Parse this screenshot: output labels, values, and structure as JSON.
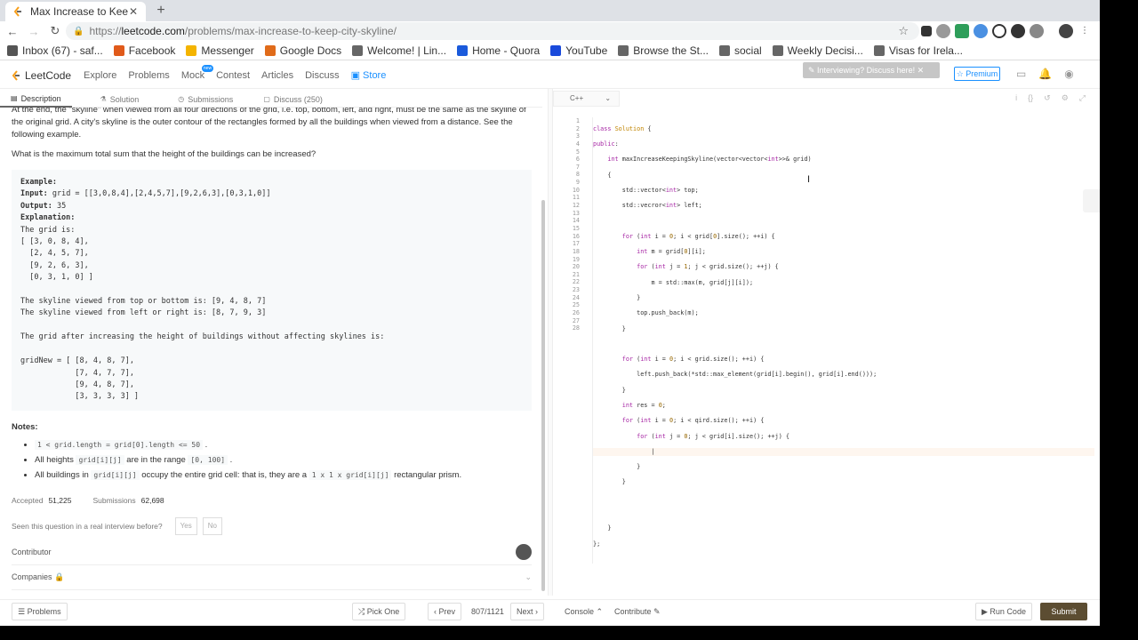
{
  "browser": {
    "tab_title": "Max Increase to Keep City",
    "new_tab_label": "+",
    "url": "https://leetcode.com/problems/max-increase-to-keep-city-skyline/",
    "url_scheme": "https://",
    "url_host": "leetcode.com",
    "url_path": "/problems/max-increase-to-keep-city-skyline/"
  },
  "bookmarks": [
    {
      "label": "Inbox (67) - saf...",
      "icon": "gmail-icon",
      "color": "#555555"
    },
    {
      "label": "Facebook",
      "icon": "facebook-icon",
      "color": "#e05a1a"
    },
    {
      "label": "Messenger",
      "icon": "messenger-icon",
      "color": "#f4b400"
    },
    {
      "label": "Google Docs",
      "icon": "docs-icon",
      "color": "#e06b1a"
    },
    {
      "label": "Welcome! | Lin...",
      "icon": "globe-icon",
      "color": "#666666"
    },
    {
      "label": "Home - Quora",
      "icon": "quora-icon",
      "color": "#1a5adb"
    },
    {
      "label": "YouTube",
      "icon": "youtube-icon",
      "color": "#1a4adb"
    },
    {
      "label": "Browse the St...",
      "icon": "globe-icon",
      "color": "#666666"
    },
    {
      "label": "social",
      "icon": "folder-icon",
      "color": "#666666"
    },
    {
      "label": "Weekly Decisi...",
      "icon": "globe-icon",
      "color": "#666666"
    },
    {
      "label": "Visas for Irela...",
      "icon": "globe-icon",
      "color": "#666666"
    }
  ],
  "nav": {
    "logo": "LeetCode",
    "links": [
      "Explore",
      "Problems",
      "Mock",
      "Contest",
      "Articles",
      "Discuss"
    ],
    "store": "Store",
    "new_badge": "new",
    "interview": "Interviewing? Discuss here!",
    "premium": "Premium"
  },
  "desc_tabs": [
    "Description",
    "Solution",
    "Submissions",
    "Discuss (250)"
  ],
  "description": {
    "para1": "At the end, the \"skyline\" when viewed from all four directions of the grid, i.e. top, bottom, left, and right, must be the same as the skyline of the original grid. A city's skyline is the outer contour of the rectangles formed by all the buildings when viewed from a distance. See the following example.",
    "para2": "What is the maximum total sum that the height of the buildings can be increased?",
    "example_label": "Example:",
    "input_label": "Input:",
    "input_value": " grid = [[3,0,8,4],[2,4,5,7],[9,2,6,3],[0,3,1,0]]",
    "output_label": "Output:",
    "output_value": " 35",
    "explanation_label": "Explanation:",
    "explanation_body": "The grid is:\n[ [3, 0, 8, 4],\n  [2, 4, 5, 7],\n  [9, 2, 6, 3],\n  [0, 3, 1, 0] ]\n\nThe skyline viewed from top or bottom is: [9, 4, 8, 7]\nThe skyline viewed from left or right is: [8, 7, 9, 3]\n\nThe grid after increasing the height of buildings without affecting skylines is:\n\ngridNew = [ [8, 4, 8, 7],\n            [7, 4, 7, 7],\n            [9, 4, 8, 7],\n            [3, 3, 3, 3] ]",
    "notes_title": "Notes:",
    "note1_code": "1 < grid.length = grid[0].length <= 50",
    "note1_tail": ".",
    "note2_pre": "All heights",
    "note2_code1": "grid[i][j]",
    "note2_mid": "are in the range",
    "note2_code2": "[0, 100]",
    "note2_tail": ".",
    "note3_pre": "All buildings in",
    "note3_code1": "grid[i][j]",
    "note3_mid": "occupy the entire grid cell: that is, they are a",
    "note3_code2": "1 x 1 x grid[i][j]",
    "note3_tail": "rectangular prism.",
    "accepted_label": "Accepted",
    "accepted_value": "51,225",
    "submissions_label": "Submissions",
    "submissions_value": "62,698",
    "seen_label": "Seen this question in a real interview before?",
    "yes": "Yes",
    "no": "No",
    "contributor": "Contributor",
    "companies": "Companies"
  },
  "editor": {
    "language": "C++",
    "line_numbers": [
      "1",
      "2",
      "3",
      "4",
      "5",
      "6",
      "7",
      "8",
      "9",
      "10",
      "11",
      "12",
      "13",
      "14",
      "15",
      "16",
      "17",
      "18",
      "19",
      "20",
      "21",
      "22",
      "23",
      "24",
      "25",
      "26",
      "27",
      "28"
    ]
  },
  "footer": {
    "problems": "Problems",
    "pick_one": "Pick One",
    "prev": "Prev",
    "page": "807/1121",
    "next": "Next",
    "console": "Console",
    "contribute": "Contribute",
    "run_code": "Run Code",
    "submit": "Submit"
  }
}
